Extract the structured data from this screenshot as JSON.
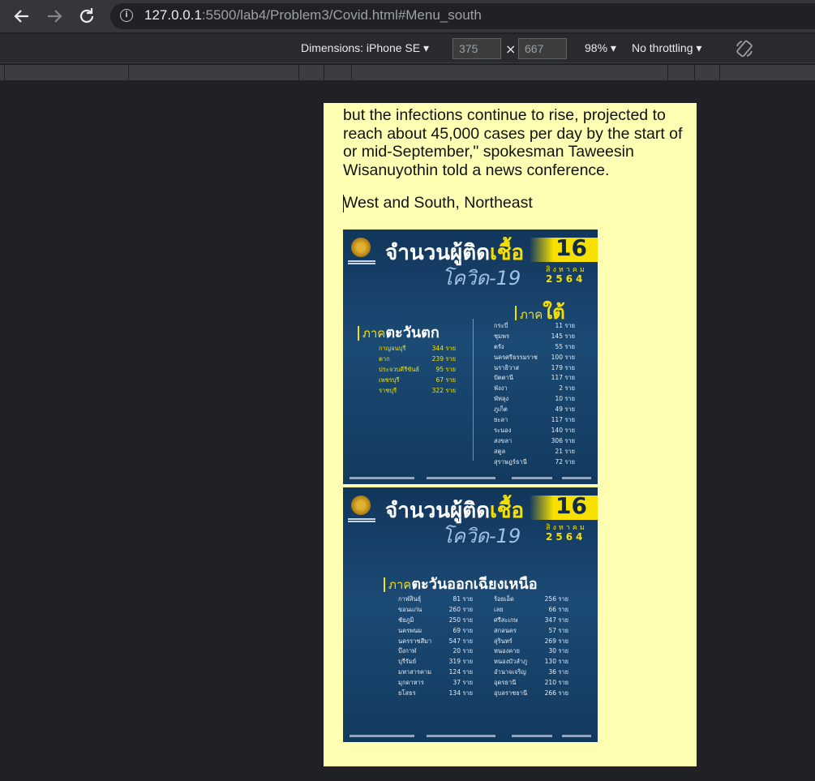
{
  "browser": {
    "url_host": "127.0.0.1",
    "url_rest": ":5500/lab4/Problem3/Covid.html#Menu_south",
    "back_icon": "arrow-left-icon",
    "forward_icon": "arrow-right-icon",
    "reload_icon": "reload-icon",
    "info_icon": "info-icon"
  },
  "devtools": {
    "dimensions_label": "Dimensions: iPhone SE",
    "width": "375",
    "times": "×",
    "height": "667",
    "zoom": "98%",
    "throttling": "No throttling",
    "rotate_icon": "rotate-icon"
  },
  "page": {
    "paragraph": "but the infections continue to rise, projected to reach about 45,000 cases per day by the start of or mid-September,\" spokesman Taweesin Wisanuyothin told a news conference.",
    "heading": "West and South, Northeast"
  },
  "poster1": {
    "title_white": "จำนวนผู้ติด",
    "title_yellow": "เชื้อ",
    "subtitle": "โควิด-19",
    "day": "16",
    "month": "สิงหาคม",
    "year": "2564",
    "south_prefix": "ภาค",
    "south_label": "ใต้",
    "west_prefix": "ภาค",
    "west_label": "ตะวันตก",
    "west": [
      {
        "name": "กาญจนบุรี",
        "value": "344 ราย"
      },
      {
        "name": "ตาก",
        "value": "239 ราย"
      },
      {
        "name": "ประจวบคีรีขันธ์",
        "value": "95 ราย"
      },
      {
        "name": "เพชรบุรี",
        "value": "67 ราย"
      },
      {
        "name": "ราชบุรี",
        "value": "322 ราย"
      }
    ],
    "south": [
      {
        "name": "กระบี่",
        "value": "11 ราย"
      },
      {
        "name": "ชุมพร",
        "value": "145 ราย"
      },
      {
        "name": "ตรัง",
        "value": "55 ราย"
      },
      {
        "name": "นครศรีธรรมราช",
        "value": "100 ราย"
      },
      {
        "name": "นราธิวาส",
        "value": "179 ราย"
      },
      {
        "name": "ปัตตานี",
        "value": "117 ราย"
      },
      {
        "name": "พังงา",
        "value": "2 ราย"
      },
      {
        "name": "พัทลุง",
        "value": "10 ราย"
      },
      {
        "name": "ภูเก็ต",
        "value": "49 ราย"
      },
      {
        "name": "ยะลา",
        "value": "117 ราย"
      },
      {
        "name": "ระนอง",
        "value": "140 ราย"
      },
      {
        "name": "สงขลา",
        "value": "306 ราย"
      },
      {
        "name": "สตูล",
        "value": "21 ราย"
      },
      {
        "name": "สุราษฎร์ธานี",
        "value": "72 ราย"
      }
    ]
  },
  "poster2": {
    "title_white": "จำนวนผู้ติด",
    "title_yellow": "เชื้อ",
    "subtitle": "โควิด-19",
    "day": "16",
    "month": "สิงหาคม",
    "year": "2564",
    "ne_prefix": "ภาค",
    "ne_label": "ตะวันออกเฉียงเหนือ",
    "left": [
      {
        "name": "กาฬสินธุ์",
        "value": "81 ราย"
      },
      {
        "name": "ขอนแก่น",
        "value": "260 ราย"
      },
      {
        "name": "ชัยภูมิ",
        "value": "250 ราย"
      },
      {
        "name": "นครพนม",
        "value": "69 ราย"
      },
      {
        "name": "นครราชสีมา",
        "value": "547 ราย"
      },
      {
        "name": "บึงกาฬ",
        "value": "20 ราย"
      },
      {
        "name": "บุรีรัมย์",
        "value": "319 ราย"
      },
      {
        "name": "มหาสารคาม",
        "value": "124 ราย"
      },
      {
        "name": "มุกดาหาร",
        "value": "37 ราย"
      },
      {
        "name": "ยโสธร",
        "value": "134 ราย"
      }
    ],
    "right": [
      {
        "name": "ร้อยเอ็ด",
        "value": "256 ราย"
      },
      {
        "name": "เลย",
        "value": "66 ราย"
      },
      {
        "name": "ศรีสะเกษ",
        "value": "347 ราย"
      },
      {
        "name": "สกลนคร",
        "value": "57 ราย"
      },
      {
        "name": "สุรินทร์",
        "value": "269 ราย"
      },
      {
        "name": "หนองคาย",
        "value": "30 ราย"
      },
      {
        "name": "หนองบัวลำภู",
        "value": "130 ราย"
      },
      {
        "name": "อำนาจเจริญ",
        "value": "36 ราย"
      },
      {
        "name": "อุดรธานี",
        "value": "210 ราย"
      },
      {
        "name": "อุบลราชธานี",
        "value": "266 ราย"
      }
    ]
  }
}
